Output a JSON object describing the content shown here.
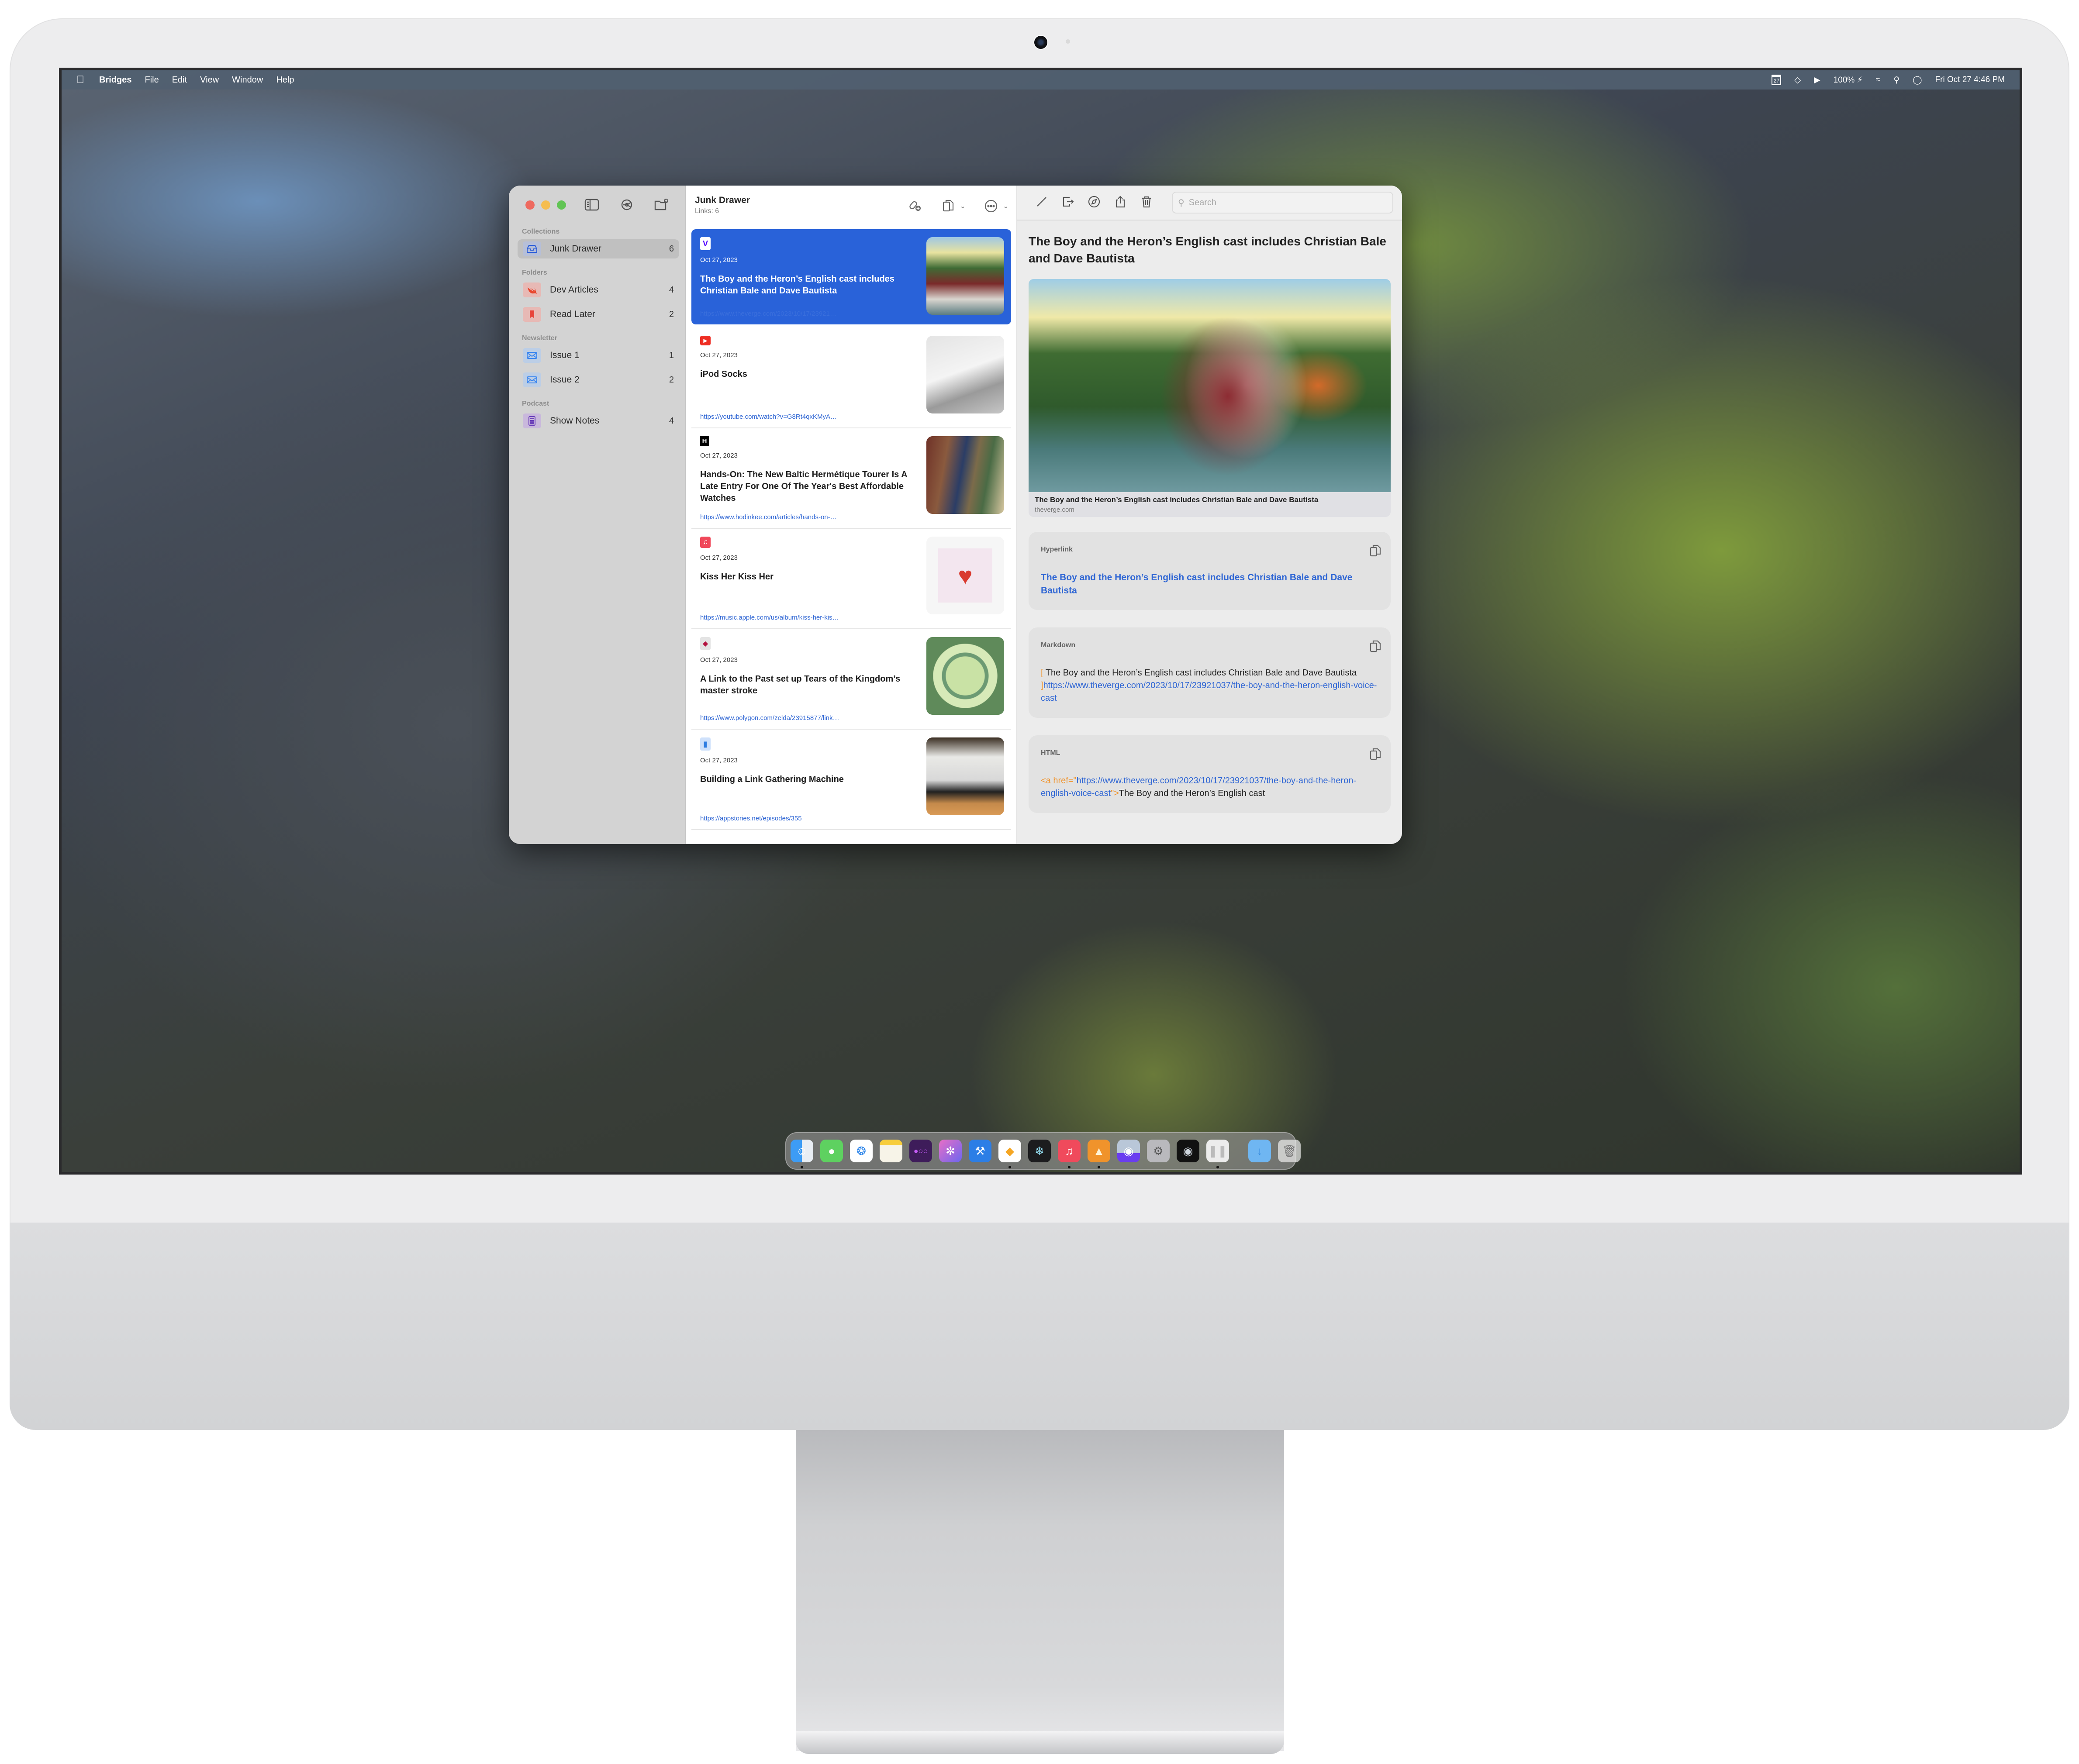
{
  "menubar": {
    "app_name": "Bridges",
    "menus": [
      "File",
      "Edit",
      "View",
      "Window",
      "Help"
    ],
    "status": {
      "calendar_day": "27",
      "battery": "100%",
      "datetime": "Fri Oct 27  4:46 PM"
    }
  },
  "sidebar": {
    "sections": [
      {
        "title": "Collections",
        "items": [
          {
            "label": "Junk Drawer",
            "count": "6",
            "icon": "tray-icon",
            "selected": true
          }
        ]
      },
      {
        "title": "Folders",
        "items": [
          {
            "label": "Dev Articles",
            "count": "4",
            "icon": "swift-icon"
          },
          {
            "label": "Read Later",
            "count": "2",
            "icon": "bookmark-icon"
          }
        ]
      },
      {
        "title": "Newsletter",
        "items": [
          {
            "label": "Issue 1",
            "count": "1",
            "icon": "envelope-icon"
          },
          {
            "label": "Issue 2",
            "count": "2",
            "icon": "envelope-icon"
          }
        ]
      },
      {
        "title": "Podcast",
        "items": [
          {
            "label": "Show Notes",
            "count": "4",
            "icon": "newspaper-icon"
          }
        ]
      }
    ]
  },
  "list": {
    "title": "Junk Drawer",
    "subtitle": "Links: 6",
    "items": [
      {
        "source": "verge",
        "date": "Oct 27, 2023",
        "title": "The Boy and the Heron’s English cast includes Christian Bale and Dave Bautista",
        "url": "https://www.theverge.com/2023/10/17/23921037/the...",
        "selected": true
      },
      {
        "source": "youtube",
        "date": "Oct 27, 2023",
        "title": "iPod Socks",
        "url": "https://youtube.com/watch?v=G8Rt4qxKMyA&si=vJz..."
      },
      {
        "source": "hodinkee",
        "date": "Oct 27, 2023",
        "title": "Hands-On: The New Baltic Hermétique Tourer Is A Late Entry For One Of The Year's Best Affordable Watches",
        "url": "https://www.hodinkee.com/articles/hands-on-baltic-..."
      },
      {
        "source": "apple-music",
        "date": "Oct 27, 2023",
        "title": "Kiss Her Kiss Her",
        "url": "https://music.apple.com/us/album/kiss-her-kiss-her/..."
      },
      {
        "source": "polygon",
        "date": "Oct 27, 2023",
        "title": "A Link to the Past set up Tears of the Kingdom’s master stroke",
        "url": "https://www.polygon.com/zelda/23915877/link-to-th..."
      },
      {
        "source": "appstories",
        "date": "Oct 27, 2023",
        "title": "Building a Link Gathering Machine",
        "url": "https://appstories.net/episodes/355"
      }
    ]
  },
  "detail": {
    "search_placeholder": "Search",
    "title": "The Boy and the Heron’s English cast includes Christian Bale and Dave Bautista",
    "preview_caption": "The Boy and the Heron’s English cast includes Christian Bale and Dave Bautista",
    "preview_domain": "theverge.com",
    "hyperlink": {
      "label": "Hyperlink",
      "text": "The Boy and the Heron’s English cast includes Christian Bale and Dave Bautista"
    },
    "markdown": {
      "label": "Markdown",
      "open": "[",
      "text": " The Boy and the Heron’s English cast includes Christian Bale and Dave Bautista ",
      "close": "]",
      "url": "https://www.theverge.com/2023/10/17/23921037/the-boy-and-the-heron-english-voice-cast"
    },
    "html": {
      "label": "HTML",
      "open": "<a href=\"",
      "url": "https://www.theverge.com/2023/10/17/23921037/the-boy-and-the-heron-english-voice-cast",
      "close": "\">",
      "text": "The Boy and the Heron’s English cast"
    }
  },
  "dock": {
    "apps": [
      "Finder",
      "Messages",
      "Safari",
      "Notes",
      "Bridges",
      "Nova",
      "Xcode",
      "Sketch",
      "Shapes",
      "Music",
      "Transmit",
      "TablePlus",
      "System Settings",
      "Logic Pro",
      "Podcasts Player"
    ],
    "running": [
      "Finder",
      "Sketch",
      "Music",
      "Transmit",
      "Podcasts Player"
    ],
    "others": [
      "Downloads",
      "Trash"
    ]
  },
  "colors": {
    "accent": "#2962d9",
    "link": "#2f66d4",
    "markup": "#f0932b",
    "close": "#ee6a5f",
    "minimize": "#f5bd4f",
    "zoom": "#61c454"
  }
}
